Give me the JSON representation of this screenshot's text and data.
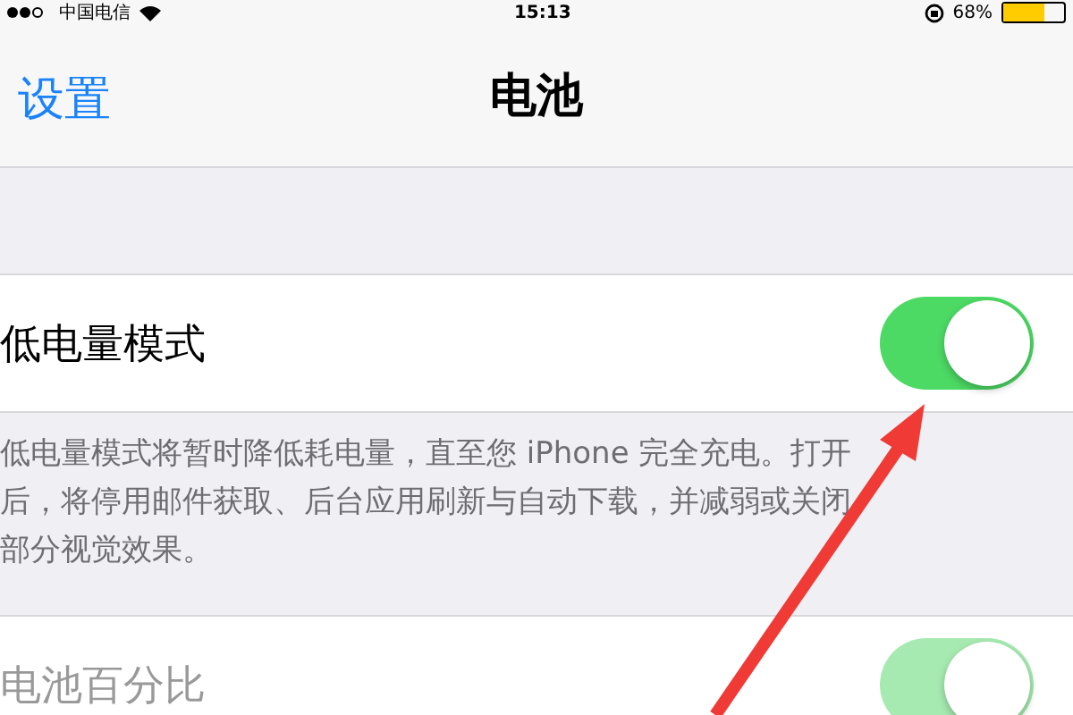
{
  "status_bar": {
    "carrier": "中国电信",
    "time": "15:13",
    "battery": "68%"
  },
  "nav": {
    "back": "设置",
    "title": "电池"
  },
  "settings": [
    {
      "label": "低电量模式",
      "on": true,
      "disabled": false,
      "footer_lines": [
        "低电量模式将暂时降低耗电量，直至您 iPhone 完全充电。打开",
        "后，将停用邮件获取、后台应用刷新与自动下载，并减弱或关闭",
        "部分视觉效果。"
      ]
    },
    {
      "label": "电池百分比",
      "on": true,
      "disabled": true
    }
  ]
}
